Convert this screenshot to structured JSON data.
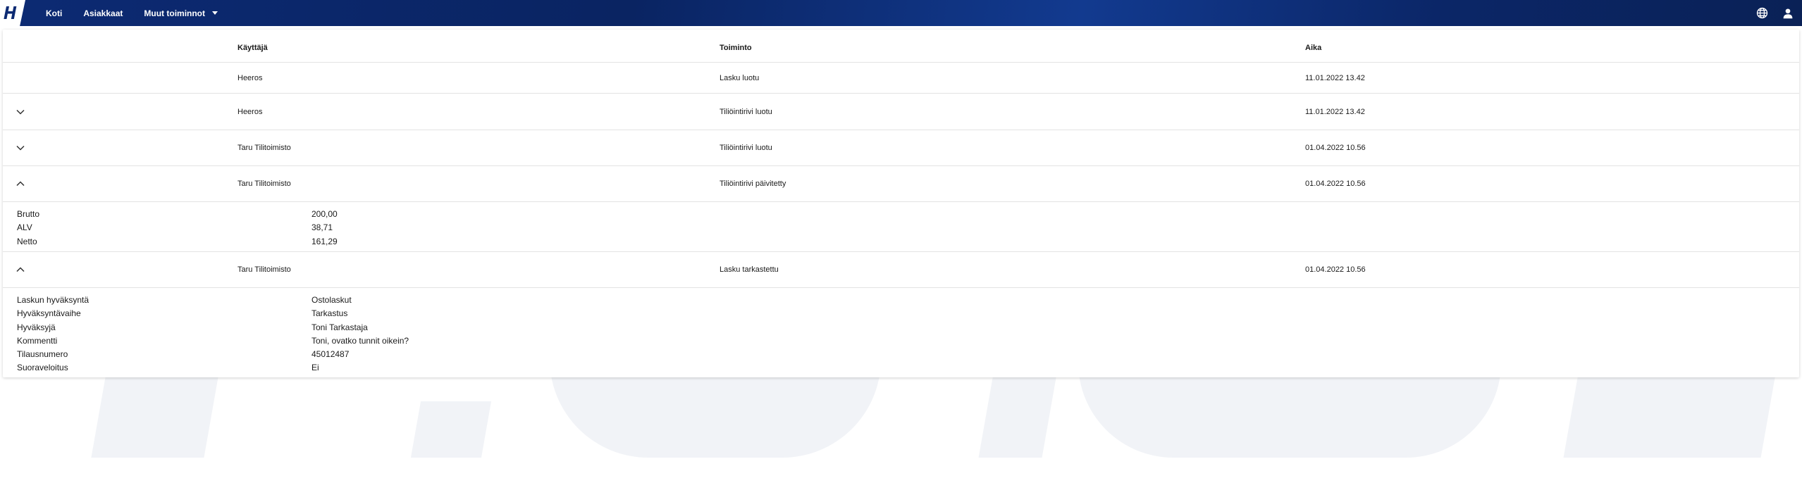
{
  "nav": {
    "items": [
      {
        "label": "Koti"
      },
      {
        "label": "Asiakkaat"
      },
      {
        "label": "Muut toiminnot"
      }
    ]
  },
  "table": {
    "headers": {
      "user": "Käyttäjä",
      "action": "Toiminto",
      "time": "Aika"
    },
    "rows": [
      {
        "user": "Heeros",
        "action": "Lasku luotu",
        "time": "11.01.2022 13.42",
        "toggle": "none"
      },
      {
        "user": "Heeros",
        "action": "Tiliöintirivi luotu",
        "time": "11.01.2022 13.42",
        "toggle": "collapsed"
      },
      {
        "user": "Taru Tilitoimisto",
        "action": "Tiliöintirivi luotu",
        "time": "01.04.2022 10.56",
        "toggle": "collapsed"
      },
      {
        "user": "Taru Tilitoimisto",
        "action": "Tiliöintirivi päivitetty",
        "time": "01.04.2022 10.56",
        "toggle": "expanded",
        "details": [
          {
            "label": "Brutto",
            "value": "200,00"
          },
          {
            "label": "ALV",
            "value": "38,71"
          },
          {
            "label": "Netto",
            "value": "161,29"
          }
        ]
      },
      {
        "user": "Taru Tilitoimisto",
        "action": "Lasku tarkastettu",
        "time": "01.04.2022 10.56",
        "toggle": "expanded",
        "details": [
          {
            "label": "Laskun hyväksyntä",
            "value": "Ostolaskut"
          },
          {
            "label": "Hyväksyntävaihe",
            "value": "Tarkastus"
          },
          {
            "label": "Hyväksyjä",
            "value": "Toni Tarkastaja"
          },
          {
            "label": "Kommentti",
            "value": "Toni, ovatko tunnit oikein?"
          },
          {
            "label": "Tilausnumero",
            "value": "45012487"
          },
          {
            "label": "Suoraveloitus",
            "value": "Ei"
          }
        ]
      }
    ]
  },
  "colors": {
    "topbar": "#0c2a73",
    "divider": "#e3e3e3",
    "watermark": "#f1f3f7"
  },
  "icons": {
    "logo": "heeros-logo-icon",
    "language": "globe-icon",
    "account": "user-icon",
    "expand": "chevron-down-icon",
    "collapse": "chevron-up-icon"
  }
}
